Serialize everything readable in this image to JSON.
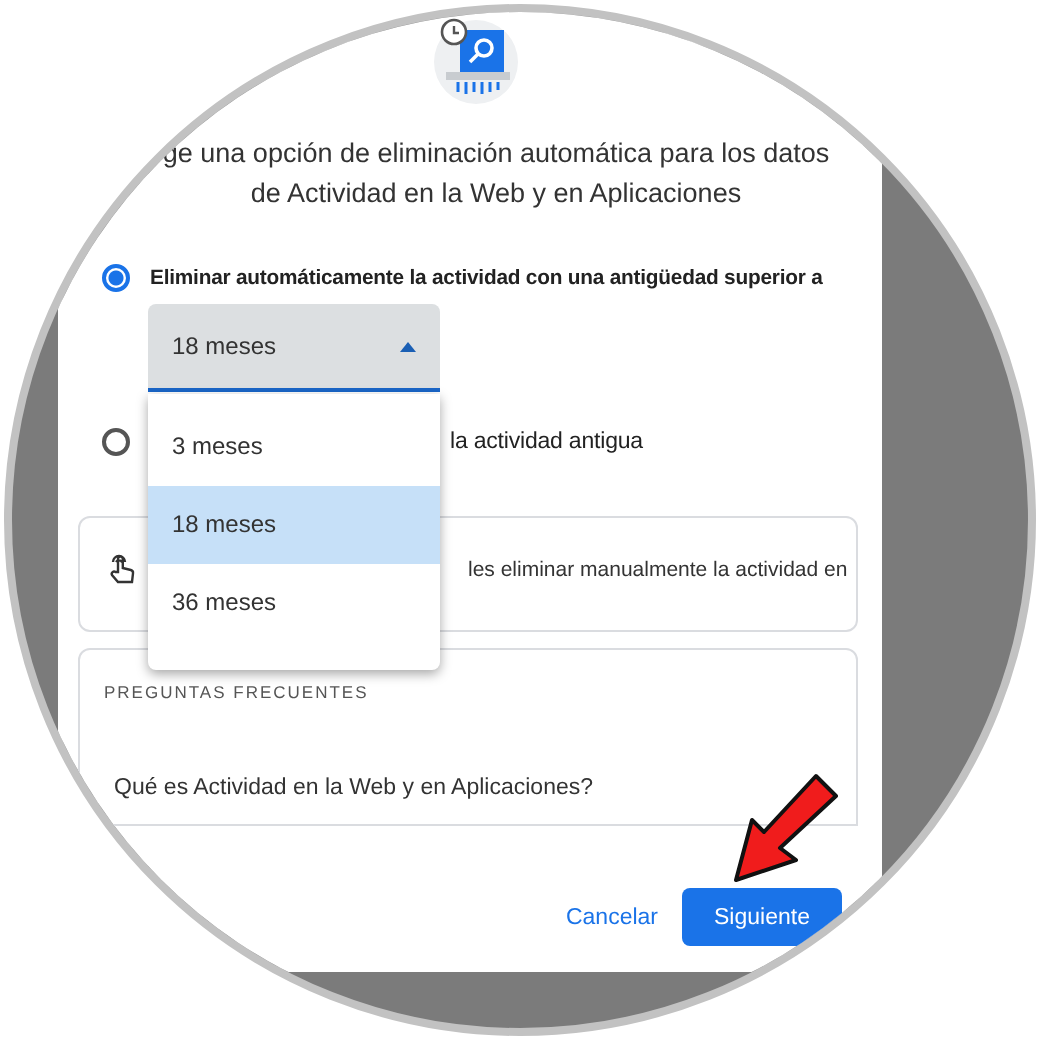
{
  "dialog": {
    "title_lines": [
      "ge una opción de eliminación automática para los datos",
      "de Actividad en la Web y en Aplicaciones"
    ],
    "options": [
      {
        "label": "Eliminar automáticamente la actividad con una antigüedad superior a",
        "selected": true
      },
      {
        "label": "la actividad antigua",
        "selected": false
      }
    ],
    "select": {
      "value": "18 meses",
      "expanded": true
    },
    "menu": [
      {
        "label": "3 meses",
        "selected": false
      },
      {
        "label": "18 meses",
        "selected": true
      },
      {
        "label": "36 meses",
        "selected": false
      }
    ],
    "manual_card": {
      "text": "les eliminar manualmente la actividad en"
    },
    "faq": {
      "heading": "PREGUNTAS FRECUENTES",
      "items": [
        "Qué es Actividad en la Web y en Aplicaciones?"
      ]
    },
    "buttons": [
      {
        "label": "Cancelar",
        "kind": "text"
      },
      {
        "label": "Siguiente",
        "kind": "primary"
      }
    ]
  }
}
